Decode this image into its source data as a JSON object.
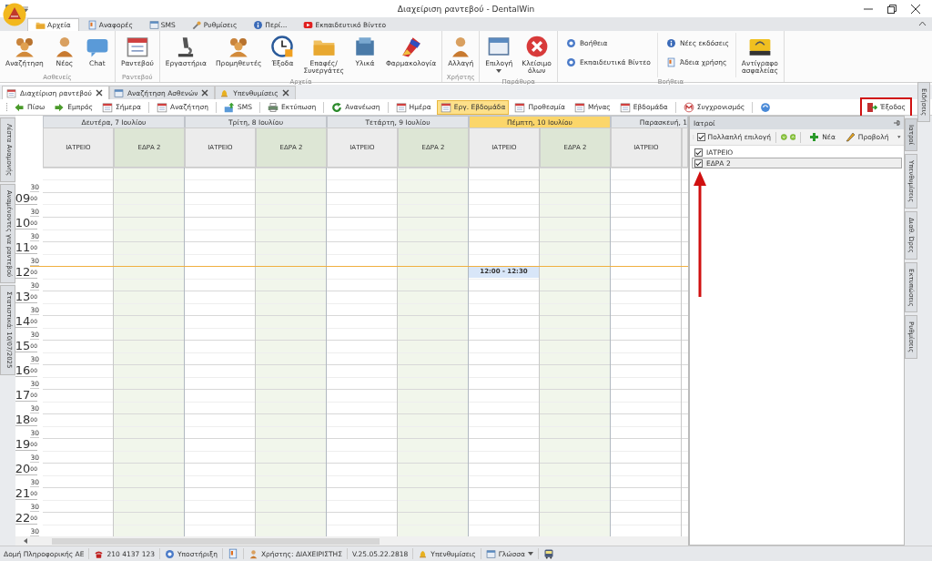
{
  "window": {
    "title": "Διαχείριση ραντεβού - DentalWin"
  },
  "ribbon_tabs": [
    {
      "label": "Αρχεία",
      "selected": true
    },
    {
      "label": "Αναφορές",
      "selected": false
    },
    {
      "label": "SMS",
      "selected": false
    },
    {
      "label": "Ρυθμίσεις",
      "selected": false
    },
    {
      "label": "Περί...",
      "selected": false
    },
    {
      "label": "Εκπαιδευτικό Βίντεο",
      "selected": false
    }
  ],
  "ribbon_groups": [
    {
      "label": "Ασθενείς",
      "items": [
        {
          "label": "Αναζήτηση",
          "kind": "large"
        },
        {
          "label": "Νέος",
          "kind": "large"
        },
        {
          "label": "Chat",
          "kind": "large"
        }
      ]
    },
    {
      "label": "Ραντεβού",
      "items": [
        {
          "label": "Ραντεβού",
          "kind": "large"
        }
      ]
    },
    {
      "label": "Αρχεία",
      "items": [
        {
          "label": "Εργαστήρια",
          "kind": "large"
        },
        {
          "label": "Προμηθευτές",
          "kind": "large"
        },
        {
          "label": "Έξοδα",
          "kind": "large"
        },
        {
          "label": "Επαφές/\nΣυνεργάτες",
          "kind": "large"
        },
        {
          "label": "Υλικά",
          "kind": "large"
        },
        {
          "label": "Φαρμακολογία",
          "kind": "large"
        }
      ]
    },
    {
      "label": "Χρήστης",
      "items": [
        {
          "label": "Αλλαγή",
          "kind": "large"
        }
      ]
    },
    {
      "label": "Παράθυρα",
      "items": [
        {
          "label": "Επιλογή",
          "kind": "large",
          "dropdown": true
        },
        {
          "label": "Κλείσιμο\nόλων",
          "kind": "large"
        }
      ]
    },
    {
      "label": "Βοήθεια",
      "items": [
        {
          "label": "Βοήθεια",
          "kind": "small"
        },
        {
          "label": "Εκπαιδευτικά Βίντεο",
          "kind": "small"
        },
        {
          "label": "Νέες εκδόσεις",
          "kind": "small"
        },
        {
          "label": "Άδεια χρήσης",
          "kind": "small"
        },
        {
          "label": "Αντίγραφο\nασφαλείας",
          "kind": "large"
        }
      ]
    }
  ],
  "doc_tabs": [
    {
      "label": "Διαχείριση ραντεβού",
      "selected": true
    },
    {
      "label": "Αναζήτηση Ασθενών",
      "selected": false
    },
    {
      "label": "Υπενθυμίσεις",
      "selected": false
    }
  ],
  "toolbar": [
    {
      "kind": "button",
      "label": "Πίσω",
      "selected": false
    },
    {
      "kind": "button",
      "label": "Εμπρός",
      "selected": false
    },
    {
      "kind": "button",
      "label": "Σήμερα",
      "selected": false
    },
    {
      "kind": "button",
      "label": "Αναζήτηση",
      "selected": false,
      "separator": true
    },
    {
      "kind": "button",
      "label": "SMS",
      "selected": false,
      "separator": true
    },
    {
      "kind": "button",
      "label": "Εκτύπωση",
      "selected": false,
      "separator": true
    },
    {
      "kind": "button",
      "label": "Ανανέωση",
      "selected": false,
      "separator": true
    },
    {
      "kind": "button",
      "label": "Ημέρα",
      "selected": false,
      "separator": true
    },
    {
      "kind": "button",
      "label": "Εργ. Εβδομάδα",
      "selected": true
    },
    {
      "kind": "button",
      "label": "Προθεσμία",
      "selected": false
    },
    {
      "kind": "button",
      "label": "Μήνας",
      "selected": false
    },
    {
      "kind": "button",
      "label": "Εβδομάδα",
      "selected": false
    },
    {
      "kind": "button",
      "label": "Συγχρονισμός",
      "selected": false,
      "separator": true
    },
    {
      "kind": "icon",
      "selected": false,
      "separator": true
    }
  ],
  "exit_button": {
    "label": "Έξοδος",
    "highlighted": true
  },
  "left_tabs": [
    "Λίστα Αναμονής",
    "Αναμένοντες για ραντεβού",
    "Στατιστικά: 10/07/2025"
  ],
  "calendar": {
    "days": [
      {
        "label": "Δευτέρα, 7 Ιουλίου",
        "today": false,
        "resources": [
          {
            "label": "ΙΑΤΡΕΙΟ"
          },
          {
            "label": "ΕΔΡΑ 2"
          }
        ]
      },
      {
        "label": "Τρίτη, 8 Ιουλίου",
        "today": false,
        "resources": [
          {
            "label": "ΙΑΤΡΕΙΟ"
          },
          {
            "label": "ΕΔΡΑ 2"
          }
        ]
      },
      {
        "label": "Τετάρτη, 9 Ιουλίου",
        "today": false,
        "resources": [
          {
            "label": "ΙΑΤΡΕΙΟ"
          },
          {
            "label": "ΕΔΡΑ 2"
          }
        ]
      },
      {
        "label": "Πέμπτη, 10 Ιουλίου",
        "today": true,
        "resources": [
          {
            "label": "ΙΑΤΡΕΙΟ",
            "appointments": [
              {
                "text": "12:00 - 12:30"
              }
            ]
          },
          {
            "label": "ΕΔΡΑ 2"
          }
        ]
      },
      {
        "label": "Παρασκευή, 1",
        "today": false,
        "resources": [
          {
            "label": "ΙΑΤΡΕΙΟ"
          }
        ]
      }
    ],
    "rows": [
      {
        "kind": "blank"
      },
      {
        "kind": "half",
        "minute": "30"
      },
      {
        "kind": "hour",
        "hour": "09",
        "minute": "00"
      },
      {
        "kind": "half",
        "minute": "30"
      },
      {
        "kind": "hour",
        "hour": "10",
        "minute": "00"
      },
      {
        "kind": "half",
        "minute": "30"
      },
      {
        "kind": "hour",
        "hour": "11",
        "minute": "00"
      },
      {
        "kind": "half",
        "minute": "30"
      },
      {
        "kind": "hour",
        "hour": "12",
        "minute": "00",
        "now": true
      },
      {
        "kind": "half",
        "minute": "30"
      },
      {
        "kind": "hour",
        "hour": "13",
        "minute": "00"
      },
      {
        "kind": "half",
        "minute": "30"
      },
      {
        "kind": "hour",
        "hour": "14",
        "minute": "00"
      },
      {
        "kind": "half",
        "minute": "30"
      },
      {
        "kind": "hour",
        "hour": "15",
        "minute": "00"
      },
      {
        "kind": "half",
        "minute": "30"
      },
      {
        "kind": "hour",
        "hour": "16",
        "minute": "00"
      },
      {
        "kind": "half",
        "minute": "30"
      },
      {
        "kind": "hour",
        "hour": "17",
        "minute": "00"
      },
      {
        "kind": "half",
        "minute": "30"
      },
      {
        "kind": "hour",
        "hour": "18",
        "minute": "00"
      },
      {
        "kind": "half",
        "minute": "30"
      },
      {
        "kind": "hour",
        "hour": "19",
        "minute": "00"
      },
      {
        "kind": "half",
        "minute": "30"
      },
      {
        "kind": "hour",
        "hour": "20",
        "minute": "00"
      },
      {
        "kind": "half",
        "minute": "30"
      },
      {
        "kind": "hour",
        "hour": "21",
        "minute": "00"
      },
      {
        "kind": "half",
        "minute": "30"
      },
      {
        "kind": "hour",
        "hour": "22",
        "minute": "00"
      },
      {
        "kind": "half",
        "minute": "30"
      }
    ]
  },
  "doctors_panel": {
    "title": "Ιατροί",
    "multi_select": {
      "label": "Πολλαπλή επιλογή",
      "checked": true
    },
    "new_label": "Νέα",
    "view_label": "Προβολή",
    "items": [
      {
        "label": "ΙΑΤΡΕΙΟ",
        "checked": true,
        "selected": false
      },
      {
        "label": "ΕΔΡΑ 2",
        "checked": true,
        "selected": true
      }
    ]
  },
  "right_tabs": [
    {
      "label": "Ιατροί",
      "selected": true
    },
    {
      "label": "Υπενθυμίσεις",
      "selected": false
    },
    {
      "label": "Διαθ. Ώρες",
      "selected": false
    },
    {
      "label": "Εκτυπώσεις",
      "selected": false
    },
    {
      "label": "Ρυθμίσεις",
      "selected": false
    }
  ],
  "news_tab": {
    "label": "Ειδήσεις"
  },
  "status_bar": [
    {
      "kind": "text",
      "label": "Δομή Πληροφορικής ΑΕ"
    },
    {
      "kind": "text",
      "label": "210 4137 123"
    },
    {
      "kind": "text",
      "label": "Υποστήριξη"
    },
    {
      "kind": "icon"
    },
    {
      "kind": "text",
      "label": "Χρήστης: ΔΙΑΧΕΙΡΙΣΤΗΣ"
    },
    {
      "kind": "text",
      "label": "V.25.05.22.2818"
    },
    {
      "kind": "text",
      "label": "Υπενθυμίσεις"
    },
    {
      "kind": "text",
      "label": "Γλώσσα",
      "dropdown": true
    },
    {
      "kind": "icon"
    }
  ]
}
